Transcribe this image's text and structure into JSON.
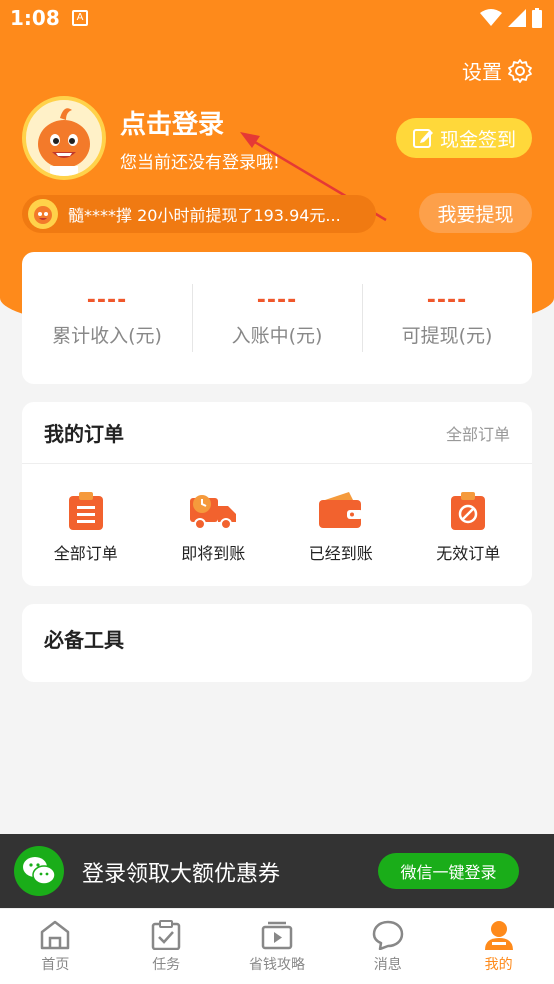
{
  "status_bar": {
    "time": "1:08",
    "app_icon_letter": "A"
  },
  "header": {
    "settings_label": "设置",
    "login_title": "点击登录",
    "login_subtitle": "您当前还没有登录哦!",
    "signin_button": "现金签到",
    "ticker_text": "髓****撑 20小时前提现了193.94元...",
    "withdraw_button": "我要提现"
  },
  "stats": [
    {
      "value": "----",
      "label": "累计收入(元)"
    },
    {
      "value": "----",
      "label": "入账中(元)"
    },
    {
      "value": "----",
      "label": "可提现(元)"
    }
  ],
  "orders": {
    "title": "我的订单",
    "all_link": "全部订单",
    "items": [
      {
        "label": "全部订单",
        "icon": "clipboard-icon"
      },
      {
        "label": "即将到账",
        "icon": "truck-icon"
      },
      {
        "label": "已经到账",
        "icon": "wallet-icon"
      },
      {
        "label": "无效订单",
        "icon": "cancel-icon"
      }
    ]
  },
  "tools": {
    "title": "必备工具"
  },
  "banner": {
    "text": "登录领取大额优惠券",
    "button": "微信一键登录"
  },
  "tabbar": [
    {
      "label": "首页",
      "icon": "home-icon"
    },
    {
      "label": "任务",
      "icon": "task-icon"
    },
    {
      "label": "省钱攻略",
      "icon": "video-icon"
    },
    {
      "label": "消息",
      "icon": "message-icon"
    },
    {
      "label": "我的",
      "icon": "profile-icon"
    }
  ],
  "colors": {
    "accent": "#fe8a1b",
    "price": "#f0572b",
    "wechat": "#1aad19"
  }
}
